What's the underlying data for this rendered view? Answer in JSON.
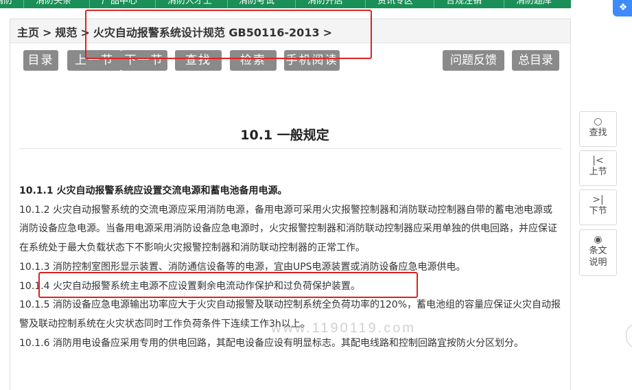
{
  "top_nav": {
    "items": [
      "消防",
      "消防头条",
      "产品中心",
      "消防人才上",
      "消防考试",
      "消防开店",
      "资讯专区",
      "合规注销",
      "消防题库"
    ]
  },
  "breadcrumb": {
    "home": "主页",
    "sep1": ">",
    "level1": "规范",
    "sep2": ">",
    "level2": "火灾自动报警系统设计规范 GB50116-2013",
    "sep3": ">"
  },
  "toolbar": {
    "toc": "目录",
    "prev": "上一节",
    "next": "下一节",
    "find": "查找",
    "search": "检索",
    "mobile": "手机阅读",
    "feedback": "问题反馈",
    "master_toc": "总目录"
  },
  "section": {
    "title": "10.1 一般规定"
  },
  "clauses": [
    {
      "text": "10.1.1 火灾自动报警系统应设置交流电源和蓄电池备用电源。",
      "bold": true
    },
    {
      "text": "10.1.2 火灾自动报警系统的交流电源应采用消防电源，备用电源可采用火灾报警控制器和消防联动控制器自带的蓄电池电源或消防设备应急电源。当备用电源采用消防设备应急电源时，火灾报警控制器和消防联动控制器应采用单独的供电回路，并应保证在系统处于最大负载状态下不影响火灾报警控制器和消防联动控制器的正常工作。",
      "bold": false
    },
    {
      "text": "10.1.3 消防控制室图形显示装置、消防通信设备等的电源，宜由UPS电源装置或消防设备应急电源供电。",
      "bold": false
    },
    {
      "text": "10.1.4 火灾自动报警系统主电源不应设置剩余电流动作保护和过负荷保护装置。",
      "bold": false
    },
    {
      "text": "10.1.5 消防设备应急电源输出功率应大于火灾自动报警及联动控制系统全负荷功率的120%，蓄电池组的容量应保证火灾自动报警及联动控制系统在火灾状态同时工作负荷条件下连续工作3h以上。",
      "bold": false
    },
    {
      "text": "10.1.6 消防用电设备应采用专用的供电回路，其配电设备应设有明显标志。其配电线路和控制回路宜按防火分区划分。",
      "bold": false
    }
  ],
  "watermark": "www.1190119.com",
  "side_tools": [
    {
      "icon": "search-icon",
      "glyph": "○",
      "label": "查找"
    },
    {
      "icon": "prev-section-icon",
      "glyph": "|<",
      "label": "上节"
    },
    {
      "icon": "next-section-icon",
      "glyph": ">|",
      "label": "下节"
    },
    {
      "icon": "eye-icon",
      "glyph": "◉",
      "label": "条文说明"
    }
  ],
  "colors": {
    "nav_green": "#1a8f57",
    "button_gray": "#8a8a8a",
    "annotation_red": "#e02020",
    "share_blue": "#3d8bff"
  }
}
